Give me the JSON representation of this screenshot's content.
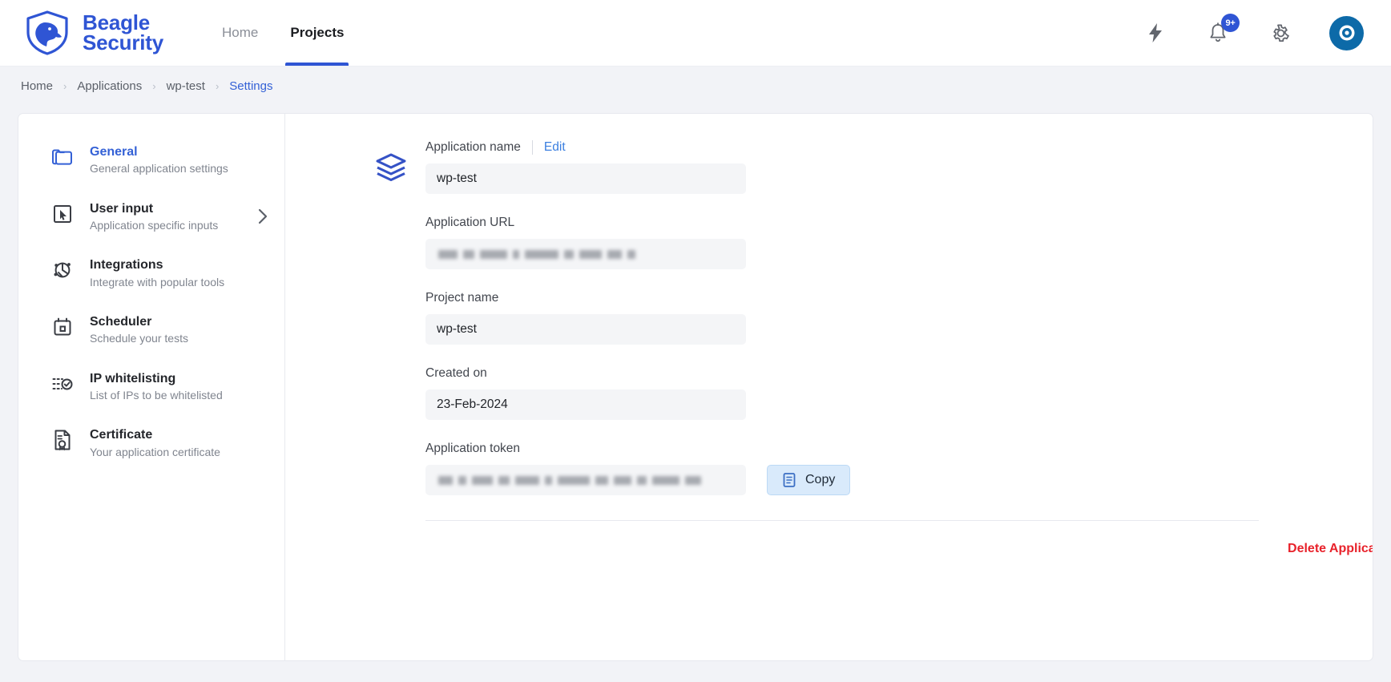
{
  "header": {
    "brand": {
      "line1": "Beagle",
      "line2": "Security",
      "logo_icon": "beagle-shield-logo"
    },
    "nav": [
      {
        "label": "Home",
        "active": false
      },
      {
        "label": "Projects",
        "active": true
      }
    ],
    "actions": {
      "bolt_icon": "lightning-bolt-icon",
      "bell_icon": "bell-icon",
      "notification_count": "9+",
      "gear_icon": "gear-icon",
      "avatar_icon": "user-avatar"
    }
  },
  "breadcrumb": {
    "items": [
      {
        "label": "Home",
        "current": false
      },
      {
        "label": "Applications",
        "current": false
      },
      {
        "label": "wp-test",
        "current": false
      },
      {
        "label": "Settings",
        "current": true
      }
    ],
    "separator": "›"
  },
  "sidebar": {
    "items": [
      {
        "title": "General",
        "subtitle": "General application settings",
        "icon": "folder-icon",
        "active": true,
        "chevron": false
      },
      {
        "title": "User input",
        "subtitle": "Application specific inputs",
        "icon": "cursor-select-icon",
        "active": false,
        "chevron": true
      },
      {
        "title": "Integrations",
        "subtitle": "Integrate with popular tools",
        "icon": "integrations-icon",
        "active": false,
        "chevron": false
      },
      {
        "title": "Scheduler",
        "subtitle": "Schedule your tests",
        "icon": "calendar-icon",
        "active": false,
        "chevron": false
      },
      {
        "title": "IP whitelisting",
        "subtitle": "List of IPs to be whitelisted",
        "icon": "list-check-icon",
        "active": false,
        "chevron": false
      },
      {
        "title": "Certificate",
        "subtitle": "Your application certificate",
        "icon": "certificate-icon",
        "active": false,
        "chevron": false
      }
    ]
  },
  "main": {
    "section_icon": "layers-icon",
    "application_name": {
      "label": "Application name",
      "edit_label": "Edit",
      "value": "wp-test"
    },
    "application_url": {
      "label": "Application URL",
      "value": "",
      "redacted": true
    },
    "project_name": {
      "label": "Project name",
      "value": "wp-test"
    },
    "created_on": {
      "label": "Created on",
      "value": "23-Feb-2024"
    },
    "application_token": {
      "label": "Application token",
      "value": "",
      "redacted": true,
      "copy_label": "Copy",
      "copy_icon": "clipboard-icon"
    },
    "delete_label": "Delete Application"
  },
  "colors": {
    "brand_blue": "#2f55d4",
    "link_blue": "#3b7fe0",
    "active_blue": "#3461d6",
    "danger_red": "#e8222b",
    "page_bg": "#f2f3f7",
    "field_bg": "#f4f5f7"
  }
}
